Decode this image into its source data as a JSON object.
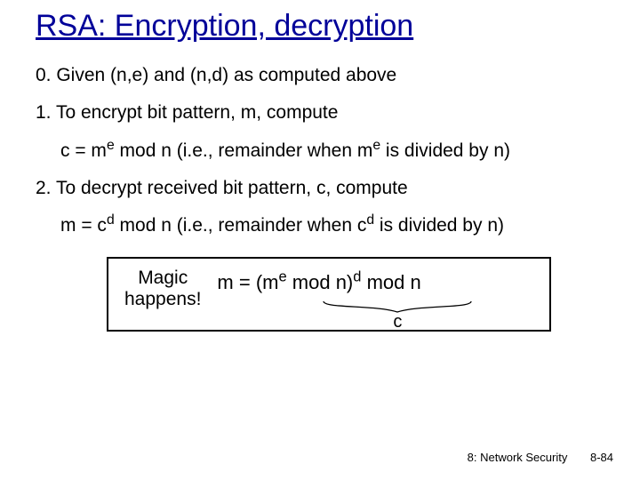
{
  "title": "RSA: Encryption, decryption",
  "step0": "0.  Given (n,e) and (n,d) as computed above",
  "step1a": "1. To encrypt bit pattern, m, compute",
  "step1b_pre": "c = m",
  "step1b_exp1": "e",
  "step1b_mid": " mod  n  (i.e., remainder when m",
  "step1b_exp2": "e",
  "step1b_post": " is divided by n)",
  "step2a": "2. To decrypt received bit pattern, c, compute",
  "step2b_pre": "m = c",
  "step2b_exp1": "d",
  "step2b_mid": " mod  n  (i.e., remainder when c",
  "step2b_exp2": "d",
  "step2b_post": " is divided by n)",
  "magic_label1": "Magic",
  "magic_label2": "happens!",
  "magic_eq_a": "m  =  (m",
  "magic_eq_e": "e",
  "magic_eq_b": " mod  n)",
  "magic_eq_d": "d",
  "magic_eq_c": " mod  n",
  "brace_label": "c",
  "footer_chapter": "8: Network Security",
  "footer_page": "8-84"
}
